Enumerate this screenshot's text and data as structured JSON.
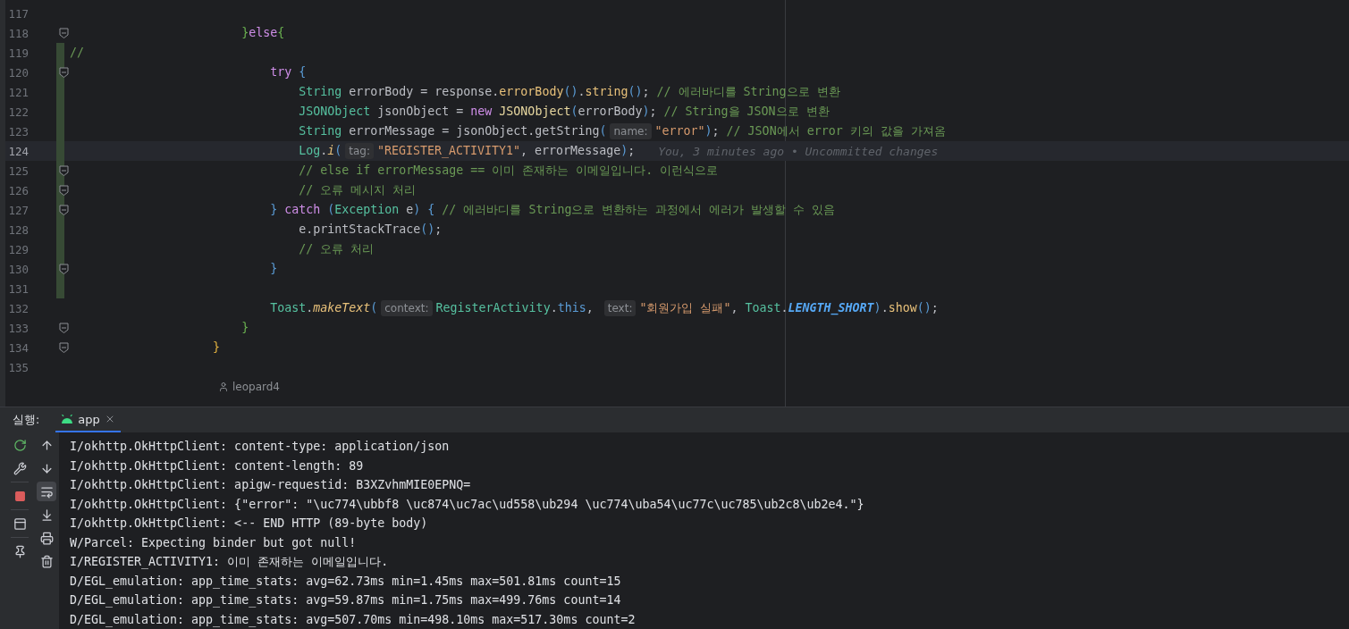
{
  "editor": {
    "lines": [
      {
        "number": "117",
        "fold": false,
        "changed": false,
        "current": false
      },
      {
        "number": "118",
        "fold": true,
        "changed": false,
        "current": false,
        "tokens": [
          {
            "text": "                        }",
            "kind": "brace"
          },
          {
            "text": "else",
            "kind": "keyword"
          },
          {
            "text": "{",
            "kind": "brace"
          }
        ]
      },
      {
        "number": "119",
        "fold": false,
        "changed": true,
        "current": false,
        "tokens": [
          {
            "text": "//",
            "kind": "comment"
          }
        ]
      },
      {
        "number": "120",
        "fold": true,
        "changed": true,
        "current": false,
        "tokens": [
          {
            "text": "                            try",
            "kind": "keyword"
          },
          {
            "text": " {",
            "kind": "paren"
          }
        ]
      },
      {
        "number": "121",
        "fold": false,
        "changed": true,
        "current": false,
        "tokens": [
          {
            "text": "                                String",
            "kind": "type"
          },
          {
            "text": " errorBody = response.",
            "kind": "var"
          },
          {
            "text": "errorBody",
            "kind": "method"
          },
          {
            "text": "()",
            "kind": "paren"
          },
          {
            "text": ".",
            "kind": "plain"
          },
          {
            "text": "string",
            "kind": "method"
          },
          {
            "text": "()",
            "kind": "paren"
          },
          {
            "text": "; ",
            "kind": "plain"
          },
          {
            "text": "// 에러바디를 String으로 변환",
            "kind": "comment"
          }
        ]
      },
      {
        "number": "122",
        "fold": false,
        "changed": true,
        "current": false,
        "tokens": [
          {
            "text": "                                JSONObject",
            "kind": "type"
          },
          {
            "text": " jsonObject = ",
            "kind": "var"
          },
          {
            "text": "new",
            "kind": "keyword"
          },
          {
            "text": " JSONObject",
            "kind": "ctor"
          },
          {
            "text": "(",
            "kind": "paren"
          },
          {
            "text": "errorBody",
            "kind": "var"
          },
          {
            "text": ")",
            "kind": "paren"
          },
          {
            "text": "; ",
            "kind": "plain"
          },
          {
            "text": "// String을 JSON으로 변환",
            "kind": "comment"
          }
        ]
      },
      {
        "number": "123",
        "fold": false,
        "changed": true,
        "current": false,
        "tokens": [
          {
            "text": "                                String",
            "kind": "type"
          },
          {
            "text": " errorMessage = jsonObject.getString",
            "kind": "var"
          },
          {
            "text": "(",
            "kind": "paren"
          },
          {
            "text": "name:",
            "kind": "hint"
          },
          {
            "text": "\"error\"",
            "kind": "string"
          },
          {
            "text": ")",
            "kind": "paren"
          },
          {
            "text": "; ",
            "kind": "plain"
          },
          {
            "text": "// JSON에서 error 키의 값을 가져옴",
            "kind": "comment"
          }
        ]
      },
      {
        "number": "124",
        "fold": false,
        "changed": true,
        "current": true,
        "tokens": [
          {
            "text": "                                Log",
            "kind": "type"
          },
          {
            "text": ".",
            "kind": "plain"
          },
          {
            "text": "i",
            "kind": "static"
          },
          {
            "text": "(",
            "kind": "paren"
          },
          {
            "text": "tag:",
            "kind": "hint"
          },
          {
            "text": "\"REGISTER_ACTIVITY1\"",
            "kind": "string"
          },
          {
            "text": ", errorMessage",
            "kind": "var"
          },
          {
            "text": ")",
            "kind": "paren"
          },
          {
            "text": ";",
            "kind": "plain"
          }
        ]
      },
      {
        "number": "125",
        "fold": true,
        "changed": true,
        "current": false,
        "tokens": [
          {
            "text": "                                // else if errorMessage == 이미 존재하는 이메일입니다. 이런식으로",
            "kind": "comment"
          }
        ]
      },
      {
        "number": "126",
        "fold": true,
        "changed": true,
        "current": false,
        "tokens": [
          {
            "text": "                                // 오류 메시지 처리",
            "kind": "comment"
          }
        ]
      },
      {
        "number": "127",
        "fold": true,
        "changed": true,
        "current": false,
        "tokens": [
          {
            "text": "                            }",
            "kind": "paren"
          },
          {
            "text": " catch ",
            "kind": "keyword"
          },
          {
            "text": "(",
            "kind": "paren"
          },
          {
            "text": "Exception",
            "kind": "type"
          },
          {
            "text": " e",
            "kind": "var"
          },
          {
            "text": ")",
            "kind": "paren"
          },
          {
            "text": " { ",
            "kind": "paren"
          },
          {
            "text": "// 에러바디를 String으로 변환하는 과정에서 에러가 발생할 수 있음",
            "kind": "comment"
          }
        ]
      },
      {
        "number": "128",
        "fold": false,
        "changed": true,
        "current": false,
        "tokens": [
          {
            "text": "                                e.printStackTrace",
            "kind": "var"
          },
          {
            "text": "()",
            "kind": "paren"
          },
          {
            "text": ";",
            "kind": "plain"
          }
        ]
      },
      {
        "number": "129",
        "fold": false,
        "changed": true,
        "current": false,
        "tokens": [
          {
            "text": "                                // 오류 처리",
            "kind": "comment"
          }
        ]
      },
      {
        "number": "130",
        "fold": true,
        "changed": true,
        "current": false,
        "tokens": [
          {
            "text": "                            }",
            "kind": "paren"
          }
        ]
      },
      {
        "number": "131",
        "fold": false,
        "changed": true,
        "current": false
      },
      {
        "number": "132",
        "fold": false,
        "changed": false,
        "current": false,
        "tokens": [
          {
            "text": "                            Toast",
            "kind": "type"
          },
          {
            "text": ".",
            "kind": "plain"
          },
          {
            "text": "makeText",
            "kind": "static"
          },
          {
            "text": "(",
            "kind": "paren"
          },
          {
            "text": "context:",
            "kind": "hint"
          },
          {
            "text": "RegisterActivity",
            "kind": "type"
          },
          {
            "text": ".",
            "kind": "plain"
          },
          {
            "text": "this",
            "kind": "this"
          },
          {
            "text": ", ",
            "kind": "plain"
          },
          {
            "text": "text:",
            "kind": "hint"
          },
          {
            "text": "\"회원가입 실패\"",
            "kind": "string"
          },
          {
            "text": ", ",
            "kind": "plain"
          },
          {
            "text": "Toast",
            "kind": "type"
          },
          {
            "text": ".",
            "kind": "plain"
          },
          {
            "text": "LENGTH_SHORT",
            "kind": "const"
          },
          {
            "text": ")",
            "kind": "paren"
          },
          {
            "text": ".",
            "kind": "plain"
          },
          {
            "text": "show",
            "kind": "method"
          },
          {
            "text": "()",
            "kind": "paren"
          },
          {
            "text": ";",
            "kind": "plain"
          }
        ]
      },
      {
        "number": "133",
        "fold": true,
        "changed": false,
        "current": false,
        "tokens": [
          {
            "text": "                        }",
            "kind": "brace"
          }
        ]
      },
      {
        "number": "134",
        "fold": true,
        "changed": false,
        "current": false,
        "tokens": [
          {
            "text": "                    }",
            "kind": "gold"
          }
        ]
      },
      {
        "number": "135",
        "fold": false,
        "changed": false,
        "current": false
      }
    ],
    "blame": "You, 3 minutes ago • Uncommitted changes",
    "author": "leopard4"
  },
  "run_panel": {
    "label": "실행:",
    "tabs": [
      {
        "label": "app",
        "selected": true
      }
    ],
    "tools": [
      {
        "kind": "rerun"
      },
      {
        "kind": "settings"
      },
      {
        "kind": "stop"
      },
      {
        "kind": "layout"
      },
      {
        "kind": "pin"
      }
    ],
    "console_tools": [
      {
        "kind": "up",
        "selected": false
      },
      {
        "kind": "down",
        "selected": false
      },
      {
        "kind": "wrap",
        "selected": true
      },
      {
        "kind": "scroll-end",
        "selected": false
      },
      {
        "kind": "print",
        "selected": false
      },
      {
        "kind": "delete",
        "selected": false
      }
    ],
    "log": [
      "I/okhttp.OkHttpClient: content-type: application/json",
      "I/okhttp.OkHttpClient: content-length: 89",
      "I/okhttp.OkHttpClient: apigw-requestid: B3XZvhmMIE0EPNQ=",
      "I/okhttp.OkHttpClient: {\"error\": \"\\uc774\\ubbf8 \\uc874\\uc7ac\\ud558\\ub294 \\uc774\\uba54\\uc77c\\uc785\\ub2c8\\ub2e4.\"}",
      "I/okhttp.OkHttpClient: <-- END HTTP (89-byte body)",
      "W/Parcel: Expecting binder but got null!",
      "I/REGISTER_ACTIVITY1: 이미 존재하는 이메일입니다.",
      "D/EGL_emulation: app_time_stats: avg=62.73ms min=1.45ms max=501.81ms count=15",
      "D/EGL_emulation: app_time_stats: avg=59.87ms min=1.75ms max=499.76ms count=14",
      "D/EGL_emulation: app_time_stats: avg=507.70ms min=498.10ms max=517.30ms count=2"
    ]
  }
}
